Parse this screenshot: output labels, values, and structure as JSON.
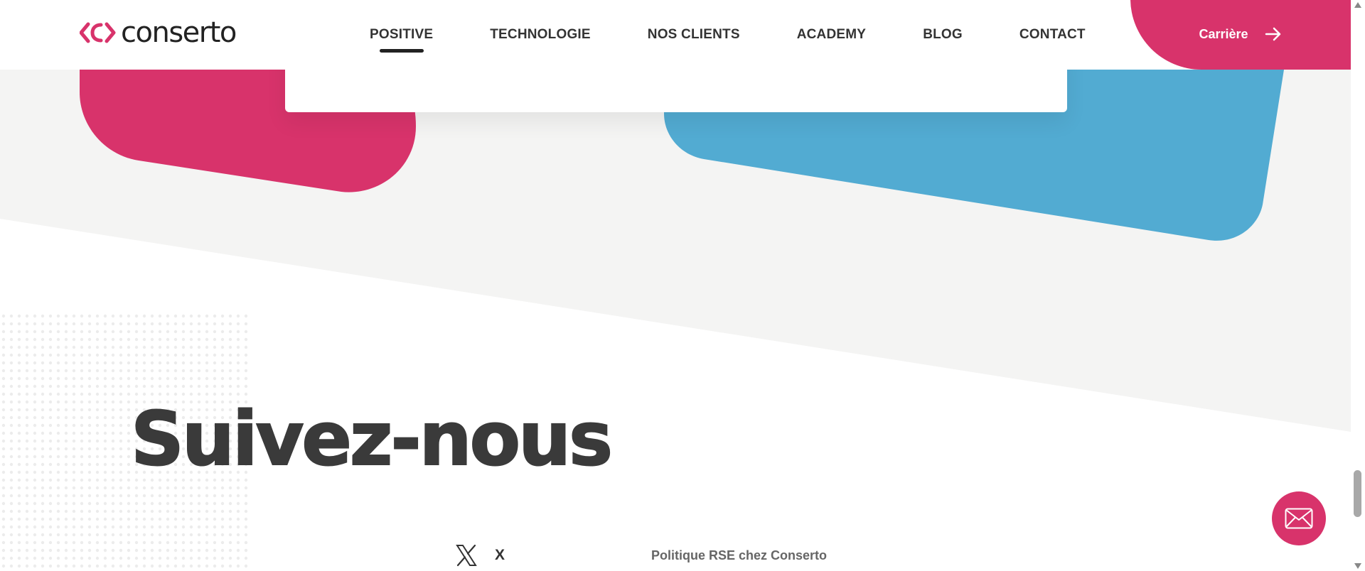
{
  "brand": {
    "name": "conserto"
  },
  "nav": {
    "items": [
      {
        "label": "POSITIVE",
        "active": true
      },
      {
        "label": "TECHNOLOGIE"
      },
      {
        "label": "NOS CLIENTS"
      },
      {
        "label": "ACADEMY"
      },
      {
        "label": "BLOG"
      },
      {
        "label": "CONTACT"
      }
    ],
    "cta_label": "Carrière"
  },
  "section": {
    "title": "Suivez-nous"
  },
  "social": {
    "x_label": "X",
    "icon": "x-logo-icon"
  },
  "footer_link": "Politique RSE chez Conserto",
  "fab_icon": "envelope-icon",
  "colors": {
    "brand_pink": "#d8336b",
    "brand_blue": "#52abd2",
    "band_grey": "#f4f4f3",
    "text_dark": "#3a3a3a"
  }
}
